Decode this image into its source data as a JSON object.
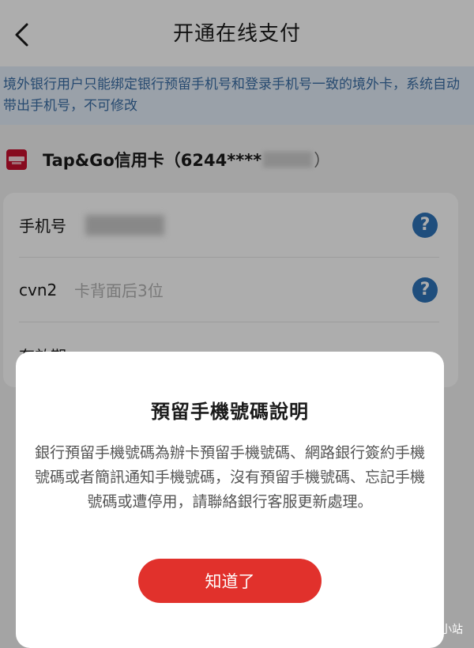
{
  "header": {
    "title": "开通在线支付",
    "back_icon": "chevron-left-icon"
  },
  "notice": {
    "text": "境外银行用户只能绑定银行预留手机号和登录手机号一致的境外卡，系统自动带出手机号，不可修改"
  },
  "card": {
    "name": "Tap&Go信用卡（6244****",
    "close_paren": "）",
    "icon": "tapgo-card-icon"
  },
  "form": {
    "rows": [
      {
        "label": "手机号",
        "value": "",
        "help_icon": "question-icon"
      },
      {
        "label": "cvn2",
        "placeholder": "卡背面后3位",
        "help_icon": "question-icon"
      },
      {
        "label": "有效期",
        "placeholder": ""
      }
    ]
  },
  "dialog": {
    "title": "預留手機號碼說明",
    "body": "銀行預留手機號碼為辦卡預留手機號碼、網路銀行簽約手機號碼或者簡訊通知手機號碼，沒有預留手機號碼、忘記手機號碼或遭停用，請聯絡銀行客服更新處理。",
    "ok_label": "知道了"
  },
  "watermark": {
    "text": "默默的小站"
  },
  "colors": {
    "accent": "#e1312c",
    "help": "#2f74b8",
    "notice_text": "#3a6ea5",
    "notice_bg": "#e4eefa"
  }
}
